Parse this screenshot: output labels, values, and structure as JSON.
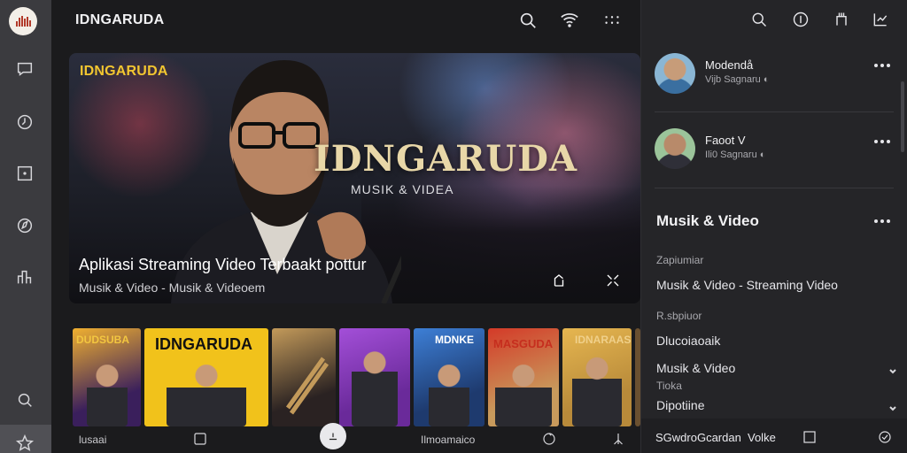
{
  "app": {
    "title": "IDNGARUDA"
  },
  "rail": {
    "logo_icon": "garuda-logo-icon",
    "items": [
      {
        "name": "chat-icon"
      },
      {
        "name": "history-icon"
      },
      {
        "name": "media-icon"
      },
      {
        "name": "compass-icon"
      },
      {
        "name": "stats-icon"
      },
      {
        "name": "search-icon"
      },
      {
        "name": "star-icon"
      }
    ]
  },
  "topbar": {
    "icons": [
      "search-icon",
      "wifi-icon",
      "grid-icon"
    ]
  },
  "hero": {
    "logo_text": "IDNGARUDA",
    "brand": "IDNGARUDA",
    "tagline": "MUSIK & VIDEA",
    "headline": "Aplikasi Streaming Video Terbaakt pottur",
    "subtitle": "Musik & Video - Musik & Videoem",
    "colors": {
      "logo": "#f2c630",
      "brand": "#e8d7a8"
    }
  },
  "thumbnails": [
    {
      "title": "DUDSUBA",
      "bg": "#3a1f5c",
      "accent": "#f0b030",
      "title_color": "#f3c640"
    },
    {
      "title": "IDNGARUDA",
      "bg": "#f1c21b",
      "accent": "#f1c21b",
      "title_color": "#111111"
    },
    {
      "title": "",
      "bg": "#2a2222",
      "accent": "#c39a5a",
      "title_color": "#ffffff"
    },
    {
      "title": "",
      "bg": "#6a2a9a",
      "accent": "#a34fd8",
      "title_color": "#ffffff"
    },
    {
      "title": "MDNKE",
      "bg": "#1e3a6e",
      "accent": "#3d7fd6",
      "title_color": "#ffffff"
    },
    {
      "title": "MASGUDA",
      "bg": "#c89a5c",
      "accent": "#d43a28",
      "title_color": "#c62e1e"
    },
    {
      "title": "IDNARAAS",
      "bg": "#b88a3a",
      "accent": "#e6b650",
      "title_color": "#f0d08a"
    }
  ],
  "bottombar": {
    "left_label": "lusaai",
    "mid_label": "Ilmoamaico",
    "icons": [
      "square-icon",
      "upload-icon",
      "sync-icon",
      "expand-icon"
    ]
  },
  "panel": {
    "top_icons": [
      "search-icon",
      "info-icon",
      "bookmark-icon",
      "chart-icon"
    ],
    "users": [
      {
        "name": "Modendå",
        "meta": "Vijb Sagnaru ◐"
      },
      {
        "name": "Faoot V",
        "meta": "Ili0 Sagnaru ◐"
      }
    ],
    "section_title": "Musik & Video",
    "rows": [
      {
        "kind": "small",
        "text": "Zapiumiar"
      },
      {
        "kind": "item",
        "text": "Musik & Video - Streaming Video"
      },
      {
        "kind": "small",
        "text": "R.sbpiuor"
      },
      {
        "kind": "item",
        "text": "Dlucoiaoaik"
      },
      {
        "kind": "item",
        "text": "Musik & Video",
        "chevron": true
      },
      {
        "kind": "small",
        "text": "Tioka"
      },
      {
        "kind": "item",
        "text": "Dipotiine",
        "chevron": true
      }
    ],
    "bottom": {
      "left": "SGwdroGcardan",
      "right": "Volke"
    }
  }
}
